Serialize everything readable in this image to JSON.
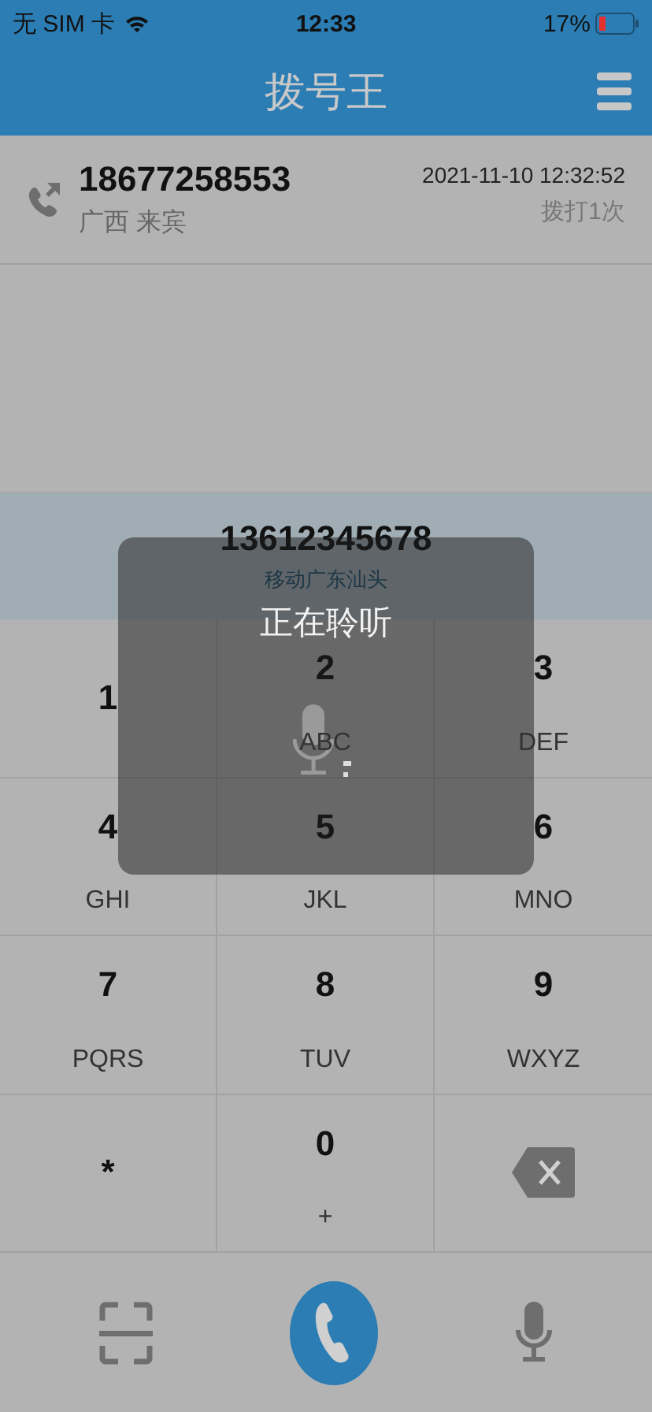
{
  "status_bar": {
    "carrier": "无 SIM 卡",
    "time": "12:33",
    "battery": "17%"
  },
  "header": {
    "title": "拨号王"
  },
  "call_log": [
    {
      "number": "18677258553",
      "location": "广西 来宾",
      "datetime": "2021-11-10 12:32:52",
      "count": "拨打1次"
    }
  ],
  "dial_display": {
    "number": "13612345678",
    "carrier_location": "移动广东汕头"
  },
  "keypad": [
    {
      "kind": "key",
      "digit": "1"
    },
    {
      "kind": "key",
      "digit": "2",
      "letters": "ABC"
    },
    {
      "kind": "key",
      "digit": "3",
      "letters": "DEF"
    },
    {
      "kind": "key",
      "digit": "4",
      "letters": "GHI"
    },
    {
      "kind": "key",
      "digit": "5",
      "letters": "JKL"
    },
    {
      "kind": "key",
      "digit": "6",
      "letters": "MNO"
    },
    {
      "kind": "key",
      "digit": "7",
      "letters": "PQRS"
    },
    {
      "kind": "key",
      "digit": "8",
      "letters": "TUV"
    },
    {
      "kind": "key",
      "digit": "9",
      "letters": "WXYZ"
    },
    {
      "kind": "key",
      "digit": "*"
    },
    {
      "kind": "key",
      "digit": "0",
      "letters": "+"
    },
    {
      "kind": "backspace"
    }
  ],
  "voice_overlay": {
    "title": "正在聆听"
  }
}
